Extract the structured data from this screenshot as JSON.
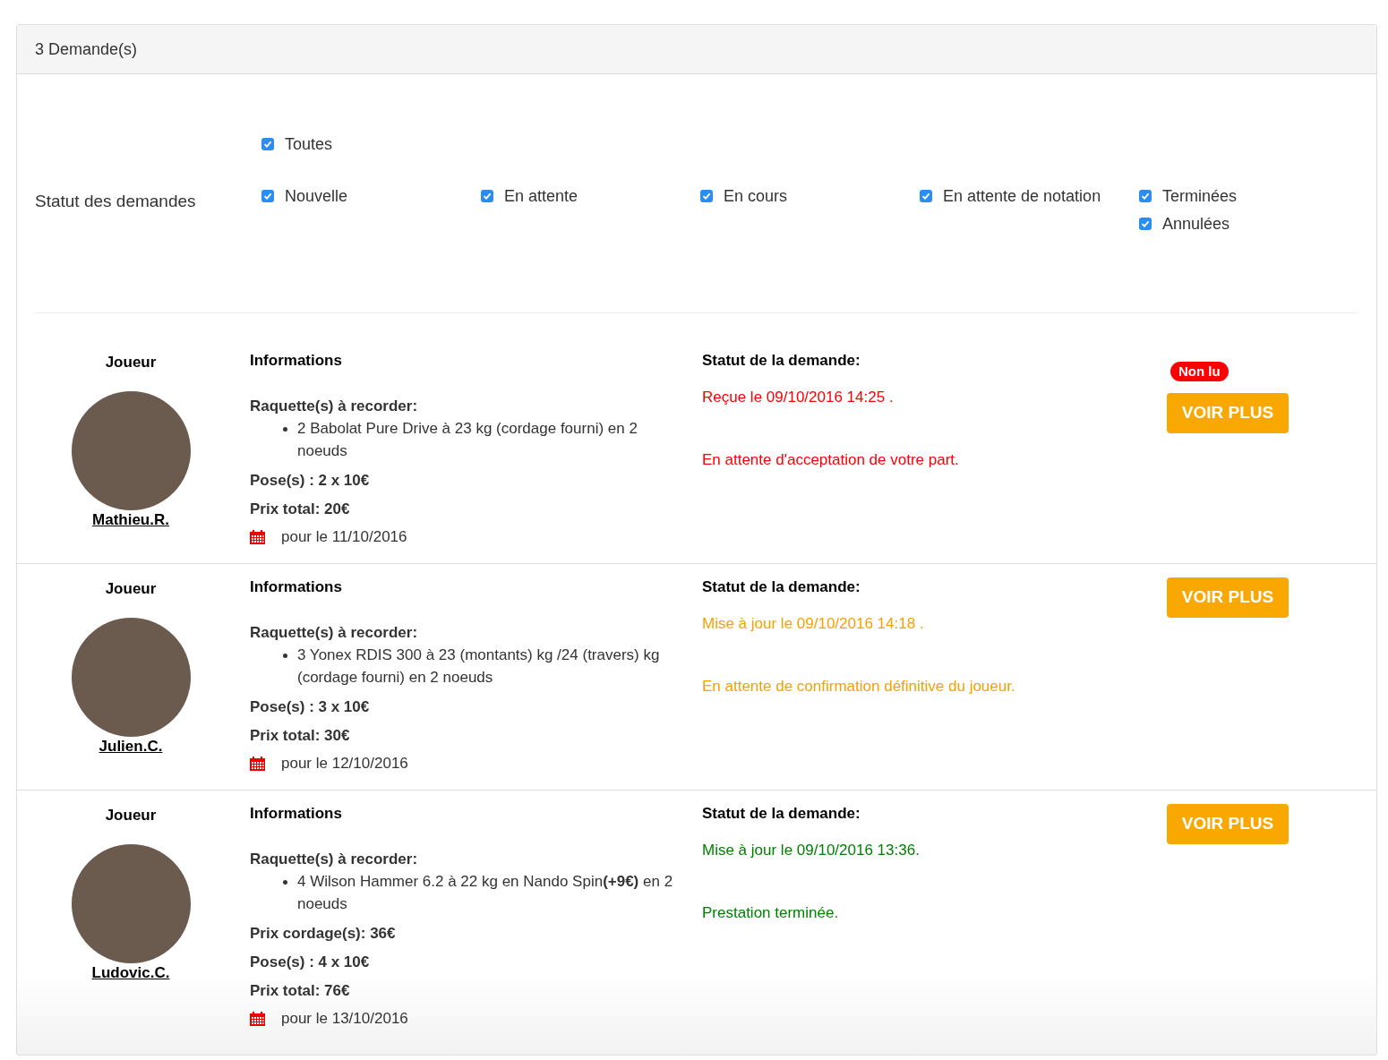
{
  "panel": {
    "title": "3 Demande(s)"
  },
  "filters": {
    "label": "Statut des demandes",
    "all": {
      "label": "Toutes",
      "checked": true
    },
    "columns": [
      [
        {
          "label": "Nouvelle",
          "checked": true
        }
      ],
      [
        {
          "label": "En attente",
          "checked": true
        }
      ],
      [
        {
          "label": "En cours",
          "checked": true
        }
      ],
      [
        {
          "label": "En attente de notation",
          "checked": true
        }
      ],
      [
        {
          "label": "Terminées",
          "checked": true
        },
        {
          "label": "Annulées",
          "checked": true
        }
      ]
    ]
  },
  "requests": [
    {
      "player_heading": "Joueur",
      "player": "Mathieu.R.",
      "info_heading": "Informations",
      "rackets_heading": "Raquette(s) à recorder:",
      "rackets": [
        "2 Babolat Pure Drive à 23 kg (cordage fourni) en 2 noeuds"
      ],
      "price_lines": [
        "Pose(s) : 2 x 10€",
        "Prix total: 20€"
      ],
      "date": "pour le 11/10/2016",
      "status_heading": "Statut de la demande:",
      "status_date": "Reçue le 09/10/2016 14:25 .",
      "status_text": "En attente d'acceptation de votre part.",
      "color": "#ff0000",
      "badge": "Non lu",
      "button": "VOIR PLUS"
    },
    {
      "player_heading": "Joueur",
      "player": "Julien.C.",
      "info_heading": "Informations",
      "rackets_heading": "Raquette(s) à recorder:",
      "rackets": [
        "3 Yonex RDIS 300 à 23 (montants) kg /24 (travers) kg (cordage fourni) en 2 noeuds"
      ],
      "price_lines": [
        "Pose(s) : 3 x 10€",
        "Prix total: 30€"
      ],
      "date": "pour le 12/10/2016",
      "status_heading": "Statut de la demande:",
      "status_date": "Mise à jour le 09/10/2016 14:18 .",
      "status_text": "En attente de confirmation définitive du joueur.",
      "color": "#f5a100",
      "button": "VOIR PLUS"
    },
    {
      "player_heading": "Joueur",
      "player": "Ludovic.C.",
      "info_heading": "Informations",
      "rackets_heading": "Raquette(s) à recorder:",
      "rackets": [
        "4 Wilson Hammer 6.2 à 22 kg en Nando Spin**(+9€)** en 2 noeuds"
      ],
      "price_lines": [
        "Prix cordage(s): 36€",
        "Pose(s) : 4 x 10€",
        "Prix total: 76€"
      ],
      "date": "pour le 13/10/2016",
      "status_heading": "Statut de la demande:",
      "status_date": "Mise à jour le 09/10/2016 13:36.",
      "status_text": "Prestation terminée.",
      "color": "#008000",
      "button": "VOIR PLUS"
    }
  ]
}
